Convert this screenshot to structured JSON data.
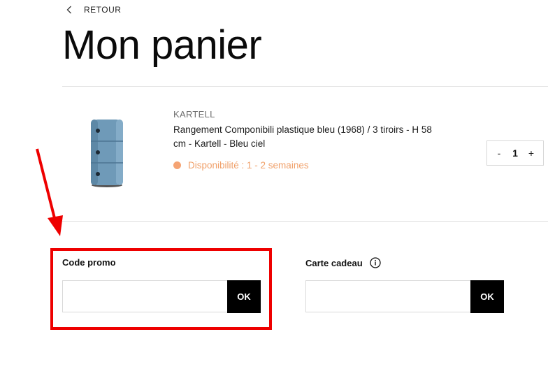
{
  "nav": {
    "back_label": "RETOUR",
    "back_icon": "chevron-left-icon"
  },
  "page": {
    "title": "Mon panier"
  },
  "cart": {
    "items": [
      {
        "brand": "KARTELL",
        "name": "Rangement Componibili plastique bleu (1968) / 3 tiroirs - H 58 cm - Kartell - Bleu ciel",
        "availability": "Disponibilité : 1 - 2 semaines",
        "quantity": "1",
        "qty_minus": "-",
        "qty_plus": "+",
        "image": "componibili-blue-storage-image"
      }
    ]
  },
  "promo": {
    "label": "Code promo",
    "placeholder": "",
    "button": "OK"
  },
  "gift": {
    "label": "Carte cadeau",
    "placeholder": "",
    "button": "OK",
    "icon": "info-icon"
  },
  "colors": {
    "availability": "#f0a06a",
    "highlight": "#ee0000",
    "button": "#000000"
  }
}
